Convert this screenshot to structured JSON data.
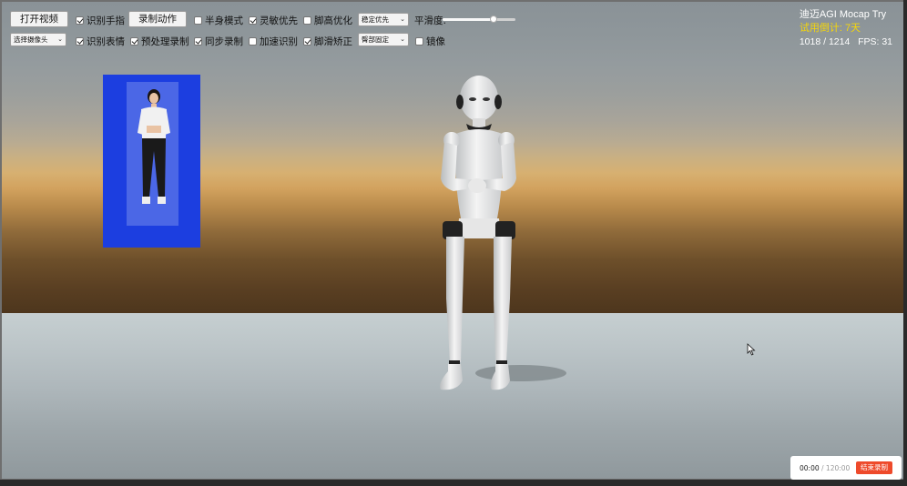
{
  "toolbar": {
    "open_video": "打开视频",
    "record_action": "录制动作",
    "camera_select": "选择摄像头",
    "checks_row1": [
      {
        "id": "hand",
        "label": "识别手指",
        "checked": true
      },
      {
        "id": "half",
        "label": "半身模式",
        "checked": false
      },
      {
        "id": "sensitive",
        "label": "灵敏优先",
        "checked": true
      },
      {
        "id": "foot-height",
        "label": "脚高优化",
        "checked": false
      }
    ],
    "checks_row2": [
      {
        "id": "face",
        "label": "识别表情",
        "checked": true
      },
      {
        "id": "preprocess",
        "label": "预处理录制",
        "checked": true
      },
      {
        "id": "sync",
        "label": "同步录制",
        "checked": true
      },
      {
        "id": "speed",
        "label": "加速识别",
        "checked": false
      },
      {
        "id": "foot-slide",
        "label": "脚滑矫正",
        "checked": true
      }
    ],
    "priority_select": "稳定优先",
    "hip_select": "臀部固定",
    "mirror": {
      "label": "镜像",
      "checked": false
    },
    "smooth_label": "平滑度:",
    "smooth_value": 0.7
  },
  "info": {
    "title": "迪迈AGI Mocap Try",
    "trial": "试用倒计: 7天",
    "frames": "1018 / 1214",
    "fps": "FPS: 31"
  },
  "recording": {
    "elapsed": "00:00",
    "separator": " / ",
    "total": "120:00",
    "end_button": "结束录制"
  },
  "colors": {
    "preview_bg": "#1c3ee0",
    "trial_text": "#f5d60a",
    "end_button": "#ee4a2b"
  }
}
